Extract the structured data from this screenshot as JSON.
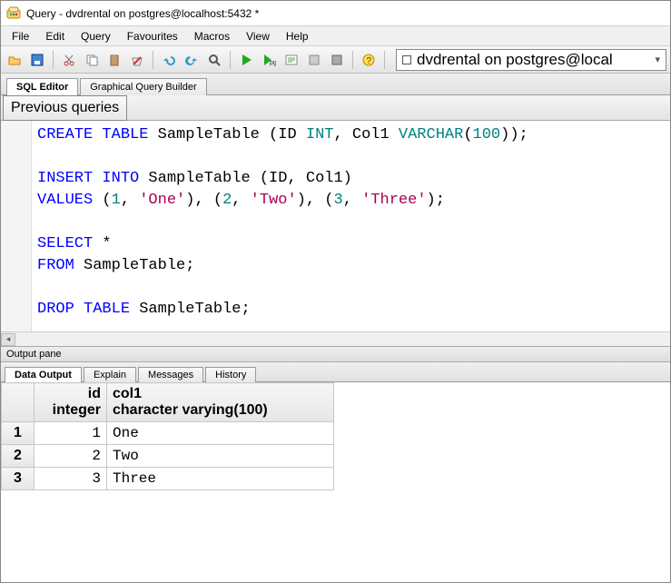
{
  "window": {
    "title": "Query - dvdrental on postgres@localhost:5432 *"
  },
  "menu": {
    "items": [
      "File",
      "Edit",
      "Query",
      "Favourites",
      "Macros",
      "View",
      "Help"
    ]
  },
  "toolbar": {
    "icons": [
      "open",
      "save",
      "cut",
      "copy",
      "paste",
      "clear",
      "undo",
      "redo",
      "find",
      "run",
      "run-pgscript",
      "explain",
      "cancel",
      "stop",
      "help"
    ],
    "connection": "dvdrental on postgres@local"
  },
  "editor_tabs": {
    "items": [
      "SQL Editor",
      "Graphical Query Builder"
    ],
    "active": 0
  },
  "prev_queries_label": "Previous queries",
  "sql": {
    "tokens": [
      [
        {
          "t": "CREATE",
          "c": "kw"
        },
        {
          "t": " ",
          "c": ""
        },
        {
          "t": "TABLE",
          "c": "kw"
        },
        {
          "t": " SampleTable ",
          "c": ""
        },
        {
          "t": "(",
          "c": ""
        },
        {
          "t": "ID ",
          "c": ""
        },
        {
          "t": "INT",
          "c": "ty"
        },
        {
          "t": ",",
          "c": ""
        },
        {
          "t": " Col1 ",
          "c": ""
        },
        {
          "t": "VARCHAR",
          "c": "ty"
        },
        {
          "t": "(",
          "c": ""
        },
        {
          "t": "100",
          "c": "num"
        },
        {
          "t": ")",
          "c": ""
        },
        {
          "t": ")",
          "c": ""
        },
        {
          "t": ";",
          "c": ""
        }
      ],
      [],
      [
        {
          "t": "INSERT",
          "c": "kw"
        },
        {
          "t": " ",
          "c": ""
        },
        {
          "t": "INTO",
          "c": "kw"
        },
        {
          "t": " SampleTable ",
          "c": ""
        },
        {
          "t": "(",
          "c": ""
        },
        {
          "t": "ID",
          "c": ""
        },
        {
          "t": ",",
          "c": ""
        },
        {
          "t": " Col1",
          "c": ""
        },
        {
          "t": ")",
          "c": ""
        }
      ],
      [
        {
          "t": "VALUES",
          "c": "kw"
        },
        {
          "t": " ",
          "c": ""
        },
        {
          "t": "(",
          "c": ""
        },
        {
          "t": "1",
          "c": "num"
        },
        {
          "t": ",",
          "c": ""
        },
        {
          "t": " ",
          "c": ""
        },
        {
          "t": "'One'",
          "c": "str"
        },
        {
          "t": ")",
          "c": ""
        },
        {
          "t": ",",
          "c": ""
        },
        {
          "t": " ",
          "c": ""
        },
        {
          "t": "(",
          "c": ""
        },
        {
          "t": "2",
          "c": "num"
        },
        {
          "t": ",",
          "c": ""
        },
        {
          "t": " ",
          "c": ""
        },
        {
          "t": "'Two'",
          "c": "str"
        },
        {
          "t": ")",
          "c": ""
        },
        {
          "t": ",",
          "c": ""
        },
        {
          "t": " ",
          "c": ""
        },
        {
          "t": "(",
          "c": ""
        },
        {
          "t": "3",
          "c": "num"
        },
        {
          "t": ",",
          "c": ""
        },
        {
          "t": " ",
          "c": ""
        },
        {
          "t": "'Three'",
          "c": "str"
        },
        {
          "t": ")",
          "c": ""
        },
        {
          "t": ";",
          "c": ""
        }
      ],
      [],
      [
        {
          "t": "SELECT",
          "c": "kw"
        },
        {
          "t": " ",
          "c": ""
        },
        {
          "t": "*",
          "c": ""
        }
      ],
      [
        {
          "t": "FROM",
          "c": "kw"
        },
        {
          "t": " SampleTable",
          "c": ""
        },
        {
          "t": ";",
          "c": ""
        }
      ],
      [],
      [
        {
          "t": "DROP",
          "c": "kw"
        },
        {
          "t": " ",
          "c": ""
        },
        {
          "t": "TABLE",
          "c": "kw"
        },
        {
          "t": " SampleTable",
          "c": ""
        },
        {
          "t": ";",
          "c": ""
        }
      ]
    ]
  },
  "output": {
    "pane_label": "Output pane",
    "tabs": {
      "items": [
        "Data Output",
        "Explain",
        "Messages",
        "History"
      ],
      "active": 0
    },
    "columns": [
      {
        "name": "id",
        "type": "integer"
      },
      {
        "name": "col1",
        "type": "character varying(100)"
      }
    ],
    "rows": [
      {
        "n": 1,
        "id": 1,
        "col1": "One"
      },
      {
        "n": 2,
        "id": 2,
        "col1": "Two"
      },
      {
        "n": 3,
        "id": 3,
        "col1": "Three"
      }
    ]
  }
}
